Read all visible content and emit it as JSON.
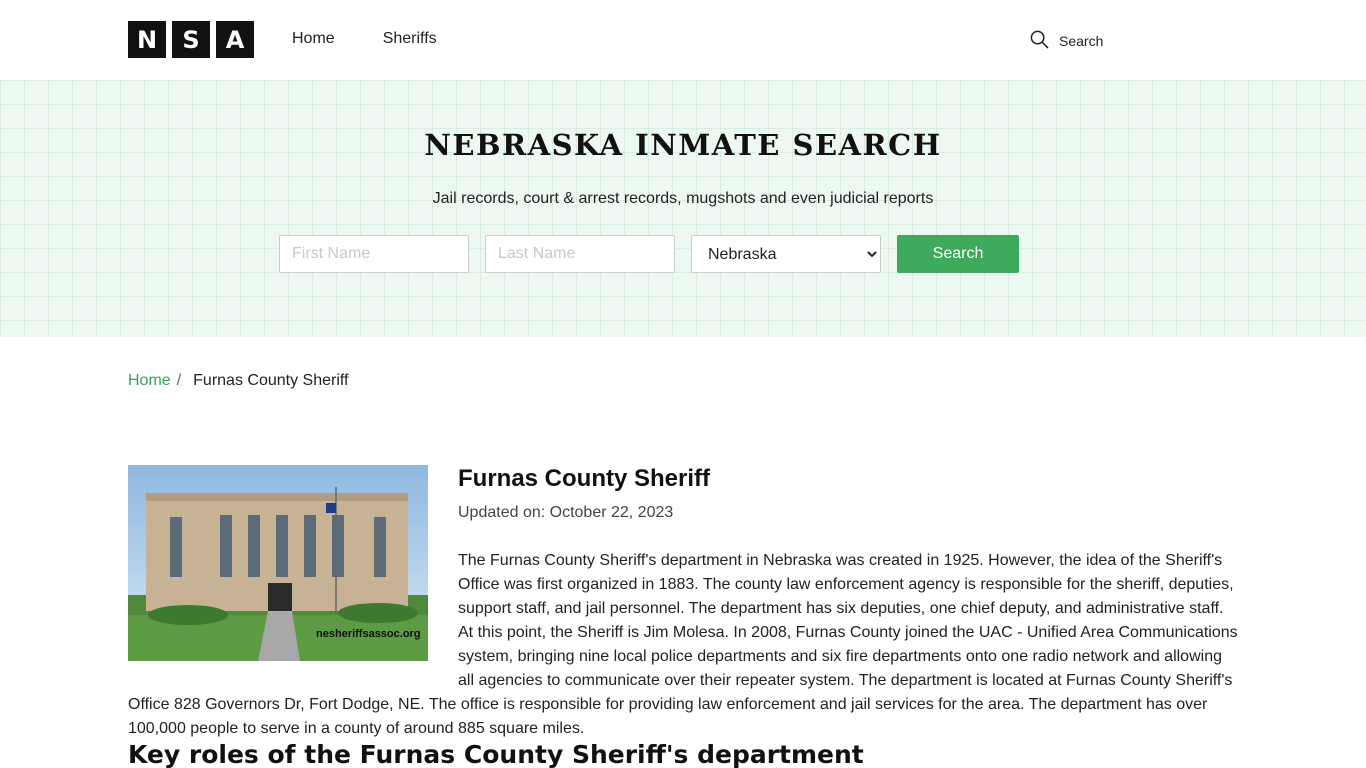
{
  "header": {
    "logo_letters": [
      "N",
      "S",
      "A"
    ],
    "nav": [
      {
        "label": "Home"
      },
      {
        "label": "Sheriffs"
      }
    ],
    "search_label": "Search"
  },
  "hero": {
    "title": "NEBRASKA INMATE SEARCH",
    "subtitle": "Jail records, court & arrest records, mugshots and even judicial reports",
    "first_name_placeholder": "First Name",
    "last_name_placeholder": "Last Name",
    "state_selected": "Nebraska",
    "search_button": "Search"
  },
  "breadcrumb": {
    "home": "Home",
    "separator": "/",
    "current": "Furnas County Sheriff"
  },
  "article": {
    "photo_watermark": "nesheriffsassoc.org",
    "title": "Furnas County Sheriff",
    "updated": "Updated on: October 22, 2023",
    "lines": [
      "The Furnas County Sheriff's department in Nebraska was created in 1925. However, the idea of the Sheriff's",
      "Office was first organized in 1883. The county law enforcement agency is responsible for the sheriff, deputies,",
      "support staff, and jail personnel. The department has six deputies, one chief deputy, and administrative staff.",
      "At this point, the Sheriff is Jim Molesa. In 2008, Furnas County joined the UAC - Unified Area Communications",
      "system, bringing nine local police departments and six fire departments onto one radio network and allowing",
      "all agencies to communicate over their repeater system. The department is located at Furnas County Sheriff's",
      "Office 828 Governors Dr, Fort Dodge, NE. The office is responsible for providing law enforcement and jail services for the area. The department has over",
      "100,000 people to serve in a county of around 885 square miles."
    ],
    "section_heading": "Key roles of the Furnas County Sheriff's department"
  },
  "colors": {
    "accent": "#3daa5c",
    "hero_bg": "#ecf8f1"
  }
}
